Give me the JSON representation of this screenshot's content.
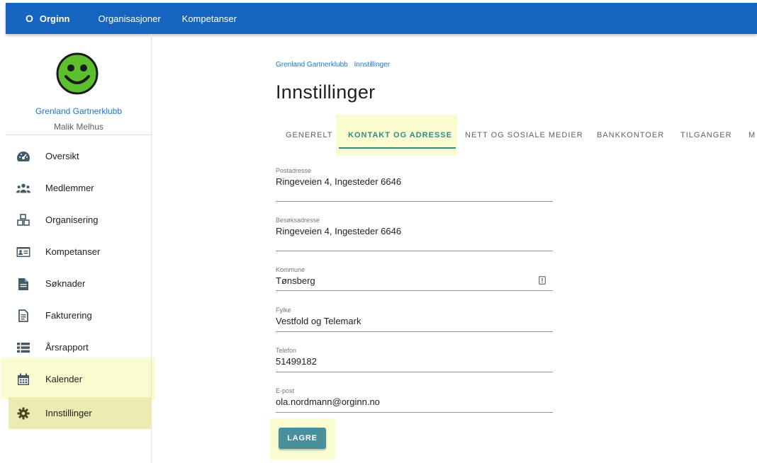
{
  "topbar": {
    "logo_mark": "O",
    "logo_text": "Orginn",
    "nav": [
      "Organisasjoner",
      "Kompetanser"
    ]
  },
  "profile": {
    "org_name": "Grenland Gartnerklubb",
    "user_name": "Malik Melhus"
  },
  "sidebar": {
    "items": [
      {
        "label": "Oversikt",
        "icon": "dashboard-icon"
      },
      {
        "label": "Medlemmer",
        "icon": "people-icon"
      },
      {
        "label": "Organisering",
        "icon": "boxes-icon"
      },
      {
        "label": "Kompetanser",
        "icon": "id-card-icon"
      },
      {
        "label": "Søknader",
        "icon": "document-icon"
      },
      {
        "label": "Fakturering",
        "icon": "invoice-icon"
      },
      {
        "label": "Årsrapport",
        "icon": "list-icon"
      },
      {
        "label": "Kalender",
        "icon": "calendar-icon"
      },
      {
        "label": "Innstillinger",
        "icon": "gear-icon"
      }
    ],
    "active_index": 8
  },
  "breadcrumb": [
    "Grenland Gartnerklubb",
    "Innstillinger"
  ],
  "page_title": "Innstillinger",
  "tabs": [
    "GENERELT",
    "KONTAKT OG ADRESSE",
    "NETT OG SOSIALE MEDIER",
    "BANKKONTOER",
    "TILGANGER",
    "M"
  ],
  "active_tab": 1,
  "form": {
    "postadresse": {
      "label": "Postadresse",
      "value": "Ringeveien 4, Ingesteder 6646"
    },
    "besoksadresse": {
      "label": "Besøksadresse",
      "value": "Ringeveien 4, Ingesteder 6646"
    },
    "kommune": {
      "label": "Kommune",
      "value": "Tønsberg"
    },
    "fylke": {
      "label": "Fylke",
      "value": "Vestfold og Telemark"
    },
    "telefon": {
      "label": "Telefon",
      "value": "51499182"
    },
    "epost": {
      "label": "E-post",
      "value": "ola.nordmann@orginn.no"
    }
  },
  "save_label": "LAGRE",
  "colors": {
    "topbar": "#1565c0",
    "accent": "#2e8b87",
    "button": "#4a8f9c",
    "highlight": "#fbfbd0",
    "smiley": "#5bbf2e"
  }
}
